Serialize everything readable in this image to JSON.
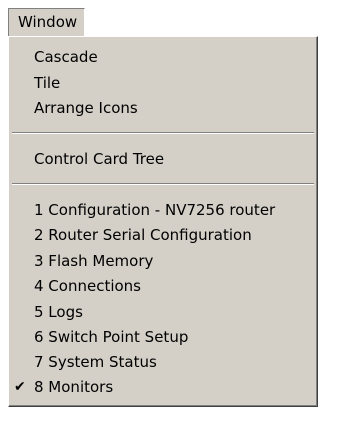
{
  "menubar": {
    "window_label": "Window"
  },
  "menu": {
    "items": [
      "Cascade",
      "Tile",
      "Arrange Icons",
      "Control Card Tree",
      "1 Configuration - NV7256 router",
      "2 Router Serial Configuration",
      "3 Flash Memory",
      "4 Connections",
      "5 Logs",
      "6 Switch Point Setup",
      "7 System Status",
      "8 Monitors"
    ],
    "checked_item": "8 Monitors",
    "check_icon": "checkmark-icon",
    "check_glyph": "✔"
  },
  "colors": {
    "menu_background": "#d4d0c8",
    "text": "#000000"
  }
}
